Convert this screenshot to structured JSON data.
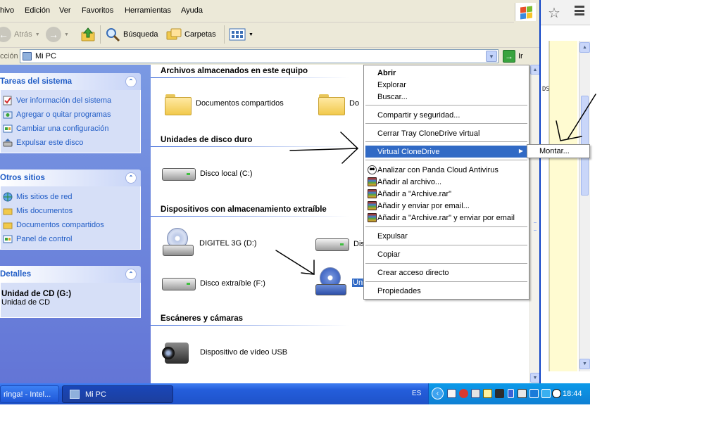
{
  "menubar": {
    "items": [
      "hivo",
      "Edición",
      "Ver",
      "Favoritos",
      "Herramientas",
      "Ayuda"
    ]
  },
  "toolbar": {
    "back": "Atrás",
    "search": "Búsqueda",
    "folders": "Carpetas"
  },
  "address": {
    "label": "cción",
    "value": "Mi PC",
    "go": "Ir"
  },
  "taskpane": {
    "system": {
      "title": "Tareas del sistema",
      "links": [
        "Ver información del sistema",
        "Agregar o quitar programas",
        "Cambiar una configuración",
        "Expulsar este disco"
      ]
    },
    "places": {
      "title": "Otros sitios",
      "links": [
        "Mis sitios de red",
        "Mis documentos",
        "Documentos compartidos",
        "Panel de control"
      ]
    },
    "details": {
      "title": "Detalles",
      "name": "Unidad de CD (G:)",
      "type": "Unidad de CD"
    }
  },
  "content": {
    "groups": {
      "stored": "Archivos almacenados en este equipo",
      "hdd": "Unidades de disco duro",
      "removable": "Dispositivos con almacenamiento extraíble",
      "scanners": "Escáneres y cámaras"
    },
    "items": {
      "shared_docs": "Documentos compartidos",
      "second_folder": "Do",
      "local_disk": "Disco local (C:)",
      "digitel": "DIGITEL 3G (D:)",
      "removable_e": "Dis",
      "removable_f": "Disco extraíble (F:)",
      "cd_g": "Uni",
      "usb_video": "Dispositivo de vídeo USB"
    }
  },
  "context_menu": {
    "open": "Abrir",
    "explore": "Explorar",
    "search": "Buscar...",
    "share": "Compartir y seguridad...",
    "close_tray": "Cerrar Tray CloneDrive virtual",
    "clonedrive": "Virtual CloneDrive",
    "panda": "Analizar con Panda Cloud Antivirus",
    "add_archive": "Añadir al archivo...",
    "add_rar": "Añadir a \"Archive.rar\"",
    "add_email": "Añadir y enviar por email...",
    "add_rar_email": "Añadir a \"Archive.rar\" y enviar por email",
    "eject": "Expulsar",
    "copy": "Copiar",
    "shortcut": "Crear acceso directo",
    "properties": "Propiedades"
  },
  "submenu": {
    "mount": "Montar..."
  },
  "browser": {
    "text_fragment": "DS"
  },
  "taskbar": {
    "browser_task": "ringa! - Intel...",
    "mypc_task": "Mi PC",
    "lang": "ES",
    "clock": "18:44"
  },
  "colors": {
    "selection": "#316ac5",
    "taskbar": "#245edb",
    "tray": "#0f8be0",
    "taskpane_link": "#215dc6"
  }
}
